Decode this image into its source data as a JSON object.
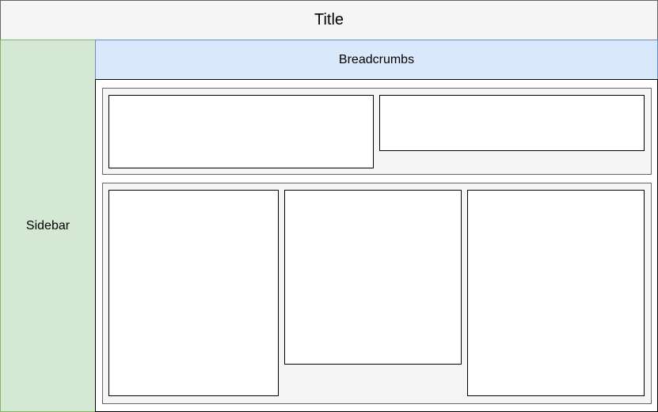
{
  "header": {
    "title": "Title"
  },
  "sidebar": {
    "label": "Sidebar"
  },
  "breadcrumbs": {
    "label": "Breadcrumbs"
  },
  "colors": {
    "title_fill": "#f5f5f5",
    "title_stroke": "#666666",
    "sidebar_fill": "#d5e8d4",
    "sidebar_stroke": "#82b366",
    "breadcrumbs_fill": "#dae8fc",
    "breadcrumbs_stroke": "#6c8ebf",
    "group_fill": "#f5f5f5",
    "panel_fill": "#ffffff"
  }
}
